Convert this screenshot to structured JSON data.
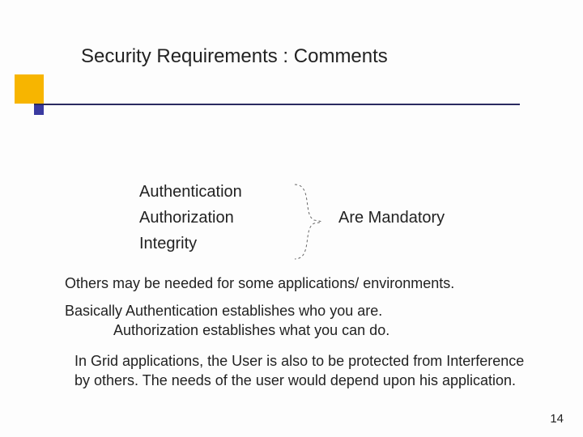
{
  "title": "Security Requirements : Comments",
  "list": {
    "item1": "Authentication",
    "item2": "Authorization",
    "item3": "Integrity"
  },
  "mandatory_label": "Are Mandatory",
  "para1": "Others may be needed for some applications/ environments.",
  "para2_line1": "Basically Authentication establishes who you are.",
  "para2_line2": "Authorization establishes what you can do.",
  "para3": "In Grid applications, the User is also to be protected from Interference by others. The needs of the user would depend upon his application.",
  "page_number": "14"
}
